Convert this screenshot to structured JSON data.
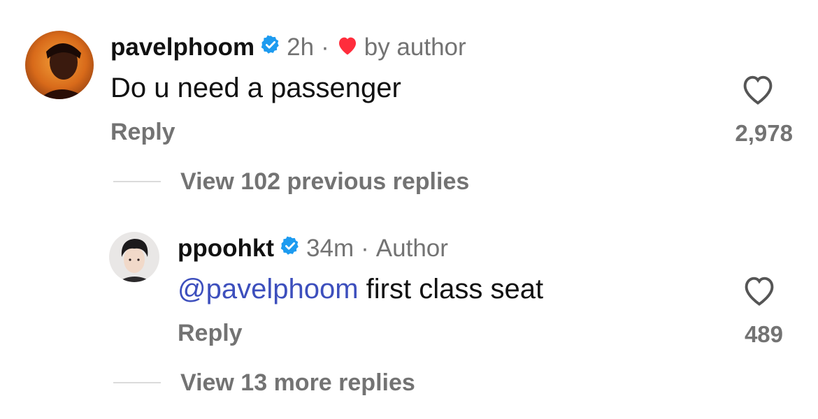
{
  "comments": [
    {
      "username": "pavelphoom",
      "time": "2h",
      "separator": "·",
      "liked_label": "by author",
      "text": "Do u need a passenger",
      "reply_label": "Reply",
      "likes": "2,978",
      "icons": {
        "verified": "verified-badge-icon",
        "liked": "heart-filled-icon",
        "like": "heart-outline-icon"
      }
    },
    {
      "username": "ppoohkt",
      "time": "34m",
      "separator": "·",
      "role": "Author",
      "mention": "@pavelphoom",
      "text": " first class seat",
      "reply_label": "Reply",
      "likes": "489",
      "icons": {
        "verified": "verified-badge-icon",
        "like": "heart-outline-icon"
      }
    }
  ],
  "view_previous": "View 102 previous replies",
  "view_more": "View 13 more replies",
  "colors": {
    "verified": "#1d9bf0",
    "liked_heart": "#ff2d3c",
    "mention": "#3d4fbd",
    "meta": "#737373",
    "divider": "#dbdbdb"
  }
}
